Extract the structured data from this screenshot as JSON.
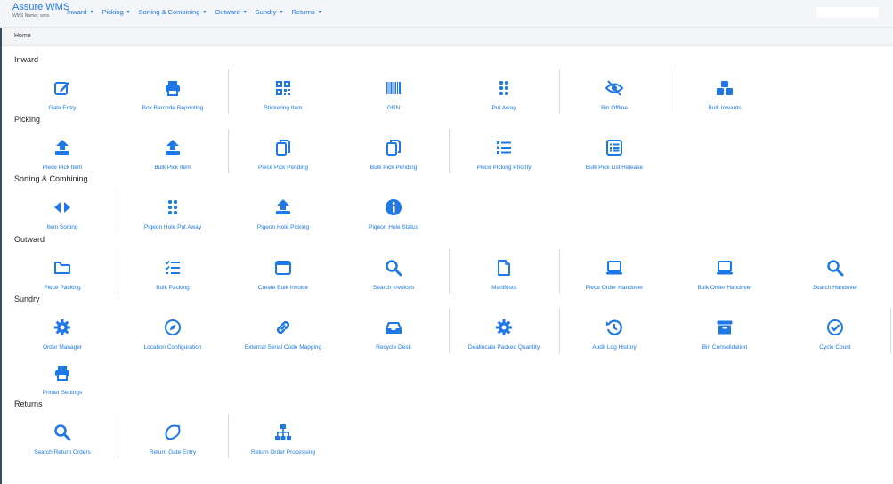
{
  "app": {
    "title": "Assure WMS",
    "subtitle": "WMS Name : wms"
  },
  "nav": [
    {
      "label": "Inward"
    },
    {
      "label": "Picking"
    },
    {
      "label": "Sorting & Combining"
    },
    {
      "label": "Outward"
    },
    {
      "label": "Sundry"
    },
    {
      "label": "Returns"
    }
  ],
  "breadcrumb": "Home",
  "colors": {
    "accent": "#1e78e6"
  },
  "sections": [
    {
      "title": "Inward",
      "items": [
        {
          "label": "Gate Entry",
          "icon": "edit-icon"
        },
        {
          "label": "Box Barcode Reprinting",
          "icon": "printer-icon"
        },
        {
          "label": "Stickering Item",
          "icon": "qrcode-icon"
        },
        {
          "label": "GRN",
          "icon": "barcode-icon"
        },
        {
          "label": "Put Away",
          "icon": "grip-icon"
        },
        {
          "label": "Bin Offline",
          "icon": "eye-slash-icon"
        },
        {
          "label": "Bulk Inwards",
          "icon": "cubes-icon"
        }
      ]
    },
    {
      "title": "Picking",
      "items": [
        {
          "label": "Piece Pick Item",
          "icon": "upload-icon"
        },
        {
          "label": "Bulk Pick Item",
          "icon": "upload-icon"
        },
        {
          "label": "Piece Pick Pending",
          "icon": "copy-icon"
        },
        {
          "label": "Bulk Pick Pending",
          "icon": "copy-icon"
        },
        {
          "label": "Piece Picking Priority",
          "icon": "list-icon"
        },
        {
          "label": "Bulk Pick List Release",
          "icon": "list-alt-icon"
        }
      ]
    },
    {
      "title": "Sorting & Combining",
      "items": [
        {
          "label": "Item Sorting",
          "icon": "arrows-h-icon"
        },
        {
          "label": "Pigeon Hole Put Away",
          "icon": "grip-icon"
        },
        {
          "label": "Pigeon Hole Picking",
          "icon": "upload-icon"
        },
        {
          "label": "Pigeon Hole Status",
          "icon": "info-icon"
        }
      ]
    },
    {
      "title": "Outward",
      "items": [
        {
          "label": "Piece Packing",
          "icon": "folder-icon"
        },
        {
          "label": "Bulk Packing",
          "icon": "tasks-icon"
        },
        {
          "label": "Create Bulk Invoice",
          "icon": "window-icon"
        },
        {
          "label": "Search Invoices",
          "icon": "search-icon"
        },
        {
          "label": "Manifests",
          "icon": "file-icon"
        },
        {
          "label": "Piece Order Handover",
          "icon": "laptop-icon"
        },
        {
          "label": "Bulk Order Handover",
          "icon": "laptop-icon"
        },
        {
          "label": "Search Handover",
          "icon": "search-icon"
        }
      ]
    },
    {
      "title": "Sundry",
      "items": [
        {
          "label": "Order Manager",
          "icon": "gear-icon"
        },
        {
          "label": "Location Configuration",
          "icon": "compass-icon"
        },
        {
          "label": "External Serial Code Mapping",
          "icon": "link-icon"
        },
        {
          "label": "Recycle Desk",
          "icon": "inbox-icon"
        },
        {
          "label": "Deallocate Packed Quantity",
          "icon": "gear-icon"
        },
        {
          "label": "Audit Log History",
          "icon": "history-icon"
        },
        {
          "label": "Bin Consolidation",
          "icon": "archive-icon"
        },
        {
          "label": "Cycle Count",
          "icon": "check-circle-icon"
        },
        {
          "label": "Printer Settings",
          "icon": "printer-icon"
        }
      ]
    },
    {
      "title": "Returns",
      "items": [
        {
          "label": "Search Return Orders",
          "icon": "search-icon"
        },
        {
          "label": "Return Gate Entry",
          "icon": "lemon-icon"
        },
        {
          "label": "Return Order Processing",
          "icon": "sitemap-icon"
        }
      ]
    }
  ]
}
